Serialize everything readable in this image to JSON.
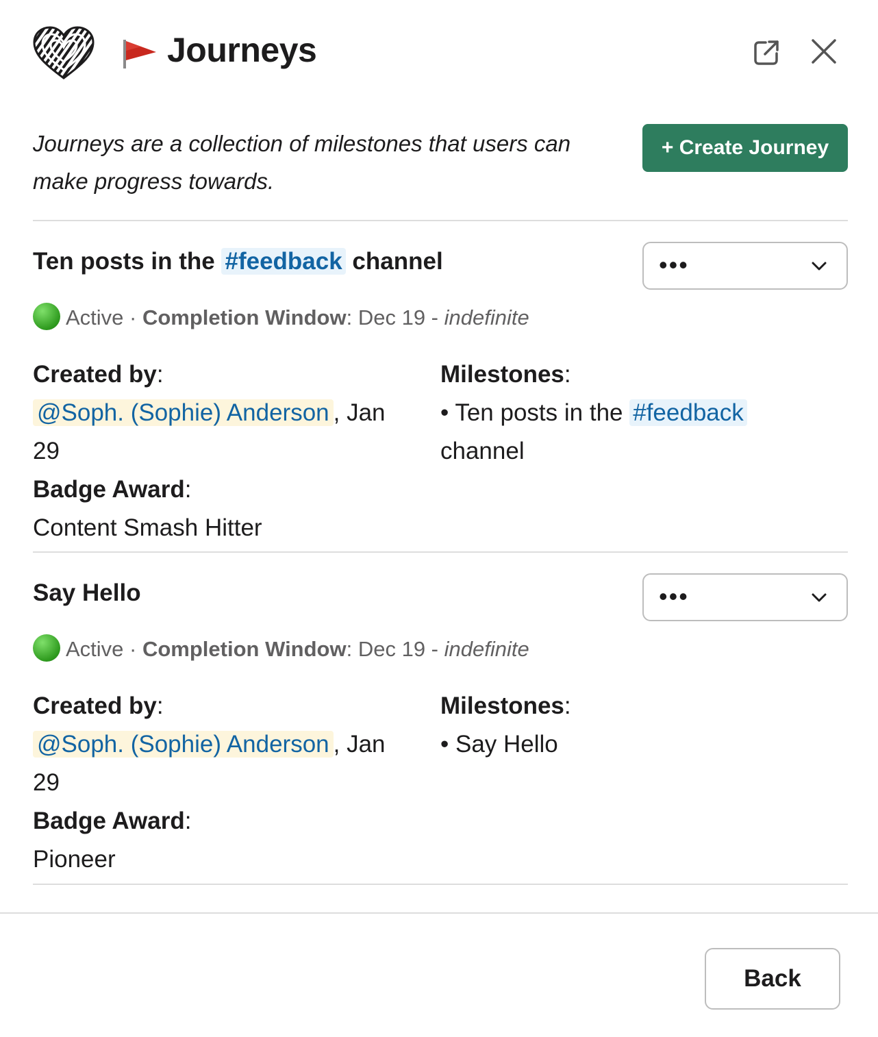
{
  "header": {
    "title": "Journeys",
    "logo_icon": "rope-heart-icon",
    "flag_icon": "red-flag-icon"
  },
  "intro": {
    "text": "Journeys are a collection of milestones that users can make progress towards."
  },
  "create_button_label": "+ Create Journey",
  "journeys": [
    {
      "title_prefix": "Ten posts in the ",
      "title_channel": "#feedback",
      "title_suffix": " channel",
      "menu_dots": "•••",
      "status": "Active",
      "separator": " · ",
      "window_label": "Completion Window",
      "window_start": ": Dec 19 - ",
      "window_end": "indefinite",
      "created_by_label": "Created by",
      "creator": "@Soph. (Sophie) Anderson",
      "created_date": ", Jan 29",
      "badge_label": "Badge Award",
      "badge": "Content Smash Hitter",
      "milestones_label": "Milestones",
      "milestone_prefix": "• Ten posts in the ",
      "milestone_channel": "#feedback",
      "milestone_suffix": " channel"
    },
    {
      "title": "Say Hello",
      "menu_dots": "•••",
      "status": "Active",
      "separator": " · ",
      "window_label": "Completion Window",
      "window_start": ": Dec 19 - ",
      "window_end": "indefinite",
      "created_by_label": "Created by",
      "creator": "@Soph. (Sophie) Anderson",
      "created_date": ", Jan 29",
      "badge_label": "Badge Award",
      "badge": "Pioneer",
      "milestones_label": "Milestones",
      "milestone": "• Say Hello"
    }
  ],
  "back_button_label": "Back",
  "colors": {
    "accent_green": "#2e7d5e",
    "link_blue": "#1264a3",
    "mention_bg": "#fdf5dc",
    "channel_bg": "#e8f3fb"
  }
}
